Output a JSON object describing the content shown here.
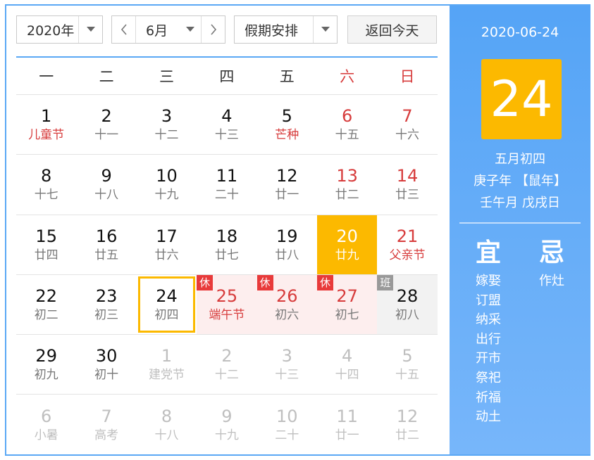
{
  "toolbar": {
    "year": "2020年",
    "month": "6月",
    "holiday": "假期安排",
    "today_button": "返回今天"
  },
  "weekdays": [
    "一",
    "二",
    "三",
    "四",
    "五",
    "六",
    "日"
  ],
  "weeks": [
    [
      {
        "day": "1",
        "lunar": "儿童节",
        "type": "festival"
      },
      {
        "day": "2",
        "lunar": "十一"
      },
      {
        "day": "3",
        "lunar": "十二"
      },
      {
        "day": "4",
        "lunar": "十三"
      },
      {
        "day": "5",
        "lunar": "芒种",
        "type": "festival"
      },
      {
        "day": "6",
        "lunar": "十五",
        "weekend": true
      },
      {
        "day": "7",
        "lunar": "十六",
        "weekend": true
      }
    ],
    [
      {
        "day": "8",
        "lunar": "十七"
      },
      {
        "day": "9",
        "lunar": "十八"
      },
      {
        "day": "10",
        "lunar": "十九"
      },
      {
        "day": "11",
        "lunar": "二十"
      },
      {
        "day": "12",
        "lunar": "廿一"
      },
      {
        "day": "13",
        "lunar": "廿二",
        "weekend": true
      },
      {
        "day": "14",
        "lunar": "廿三",
        "weekend": true
      }
    ],
    [
      {
        "day": "15",
        "lunar": "廿四"
      },
      {
        "day": "16",
        "lunar": "廿五"
      },
      {
        "day": "17",
        "lunar": "廿六"
      },
      {
        "day": "18",
        "lunar": "廿七"
      },
      {
        "day": "19",
        "lunar": "廿八"
      },
      {
        "day": "20",
        "lunar": "廿九",
        "weekend": true,
        "selected": true
      },
      {
        "day": "21",
        "lunar": "父亲节",
        "weekend": true,
        "type": "festival"
      }
    ],
    [
      {
        "day": "22",
        "lunar": "初二"
      },
      {
        "day": "23",
        "lunar": "初三"
      },
      {
        "day": "24",
        "lunar": "初四",
        "today": true
      },
      {
        "day": "25",
        "lunar": "端午节",
        "type": "festival",
        "status": "rest",
        "tag": "休"
      },
      {
        "day": "26",
        "lunar": "初六",
        "status": "rest",
        "tag": "休"
      },
      {
        "day": "27",
        "lunar": "初七",
        "status": "rest",
        "tag": "休"
      },
      {
        "day": "28",
        "lunar": "初八",
        "status": "work",
        "tag": "班"
      }
    ],
    [
      {
        "day": "29",
        "lunar": "初九"
      },
      {
        "day": "30",
        "lunar": "初十"
      },
      {
        "day": "1",
        "lunar": "建党节",
        "other": true
      },
      {
        "day": "2",
        "lunar": "十二",
        "other": true
      },
      {
        "day": "3",
        "lunar": "十三",
        "other": true
      },
      {
        "day": "4",
        "lunar": "十四",
        "other": true
      },
      {
        "day": "5",
        "lunar": "十五",
        "other": true
      }
    ],
    [
      {
        "day": "6",
        "lunar": "小暑",
        "other": true
      },
      {
        "day": "7",
        "lunar": "高考",
        "other": true
      },
      {
        "day": "8",
        "lunar": "十八",
        "other": true
      },
      {
        "day": "9",
        "lunar": "十九",
        "other": true
      },
      {
        "day": "10",
        "lunar": "二十",
        "other": true
      },
      {
        "day": "11",
        "lunar": "廿一",
        "other": true
      },
      {
        "day": "12",
        "lunar": "廿二",
        "other": true
      }
    ]
  ],
  "panel": {
    "date": "2020-06-24",
    "big_day": "24",
    "lunar_date": "五月初四",
    "year_ganzhi": "庚子年 【鼠年】",
    "month_day_ganzhi": "壬午月 戊戌日",
    "yi_title": "宜",
    "ji_title": "忌",
    "yi_items": [
      "嫁娶",
      "订盟",
      "纳采",
      "出行",
      "开市",
      "祭祀",
      "祈福",
      "动土"
    ],
    "ji_items": [
      "作灶"
    ]
  },
  "colors": {
    "accent_blue": "#5aa8f5",
    "highlight_yellow": "#fcb900",
    "holiday_red": "#d73c3c"
  }
}
